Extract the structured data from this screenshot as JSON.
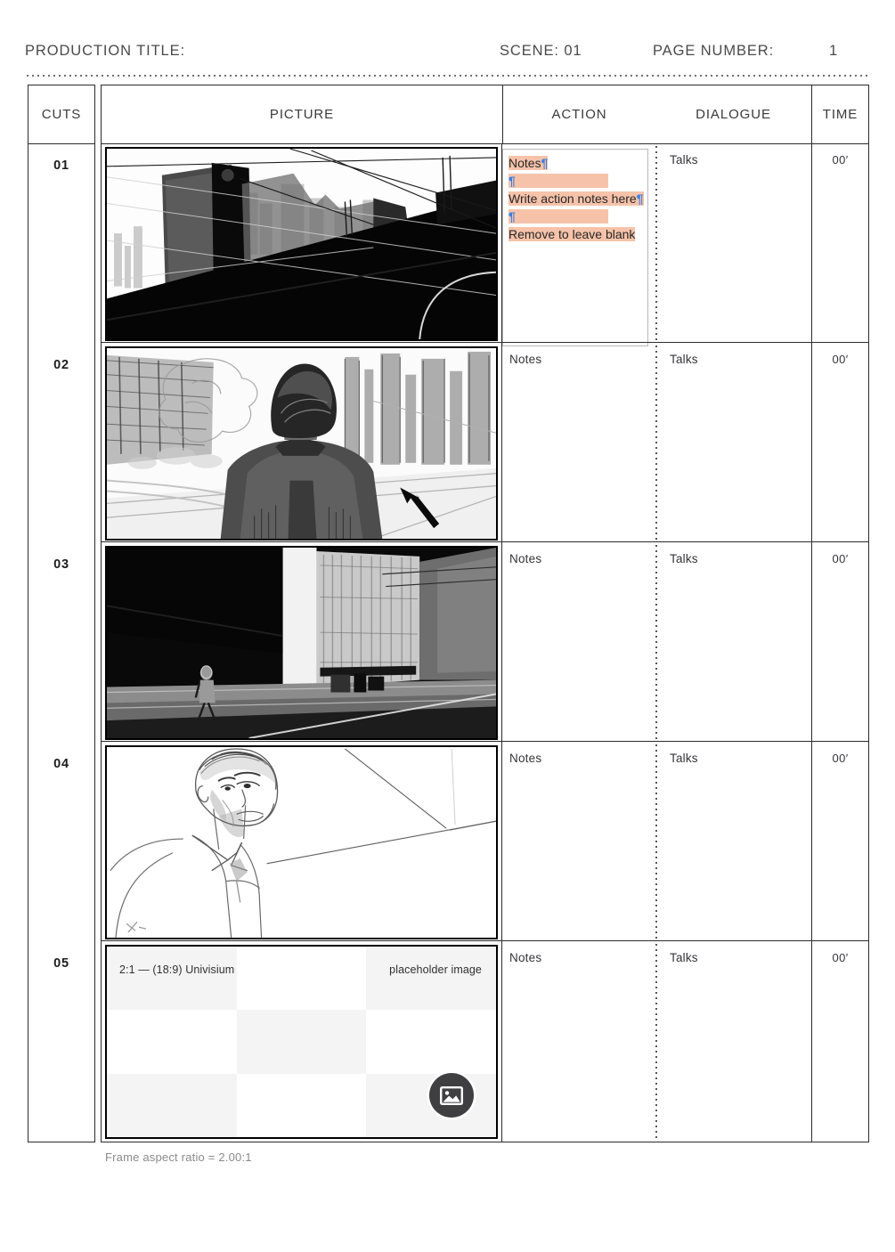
{
  "header": {
    "production_title_label": "PRODUCTION TITLE:",
    "production_title_value": "",
    "scene_label": "SCENE: 01",
    "page_number_label": "PAGE NUMBER:",
    "page_number_value": "1"
  },
  "table": {
    "columns": [
      {
        "key": "cuts",
        "label": "CUTS"
      },
      {
        "key": "picture",
        "label": "PICTURE"
      },
      {
        "key": "action",
        "label": "ACTION"
      },
      {
        "key": "dialogue",
        "label": "DIALOGUE"
      },
      {
        "key": "time",
        "label": "TIME"
      }
    ],
    "rows": [
      {
        "cut": "01",
        "picture_kind": "artwork-city-vehicle",
        "action": "Notes",
        "dialogue": "Talks",
        "time": "00′",
        "action_selected": true
      },
      {
        "cut": "02",
        "picture_kind": "artwork-man-back-city",
        "action": "Notes",
        "dialogue": "Talks",
        "time": "00′",
        "action_selected": false
      },
      {
        "cut": "03",
        "picture_kind": "artwork-night-street",
        "action": "Notes",
        "dialogue": "Talks",
        "time": "00′",
        "action_selected": false
      },
      {
        "cut": "04",
        "picture_kind": "artwork-portrait-sketch",
        "action": "Notes",
        "dialogue": "Talks",
        "time": "00′",
        "action_selected": false
      },
      {
        "cut": "05",
        "picture_kind": "placeholder",
        "action": "Notes",
        "dialogue": "Talks",
        "time": "00′",
        "action_selected": false
      }
    ]
  },
  "action_editbox": {
    "line1": "Notes",
    "line2": "",
    "line3": "Write action notes here",
    "line4": "",
    "line5": "Remove to leave blank",
    "pilcrow": "¶",
    "highlight_color": "#f6c3aa",
    "pilcrow_color": "#3d7fe0"
  },
  "placeholder": {
    "aspect_label": "2:1 — (18:9) Univisium",
    "name_label": "placeholder image",
    "icon": "image-icon",
    "icon_bg_color": "#3f3f42"
  },
  "footer": {
    "aspect_note": "Frame aspect ratio = 2.00:1"
  }
}
